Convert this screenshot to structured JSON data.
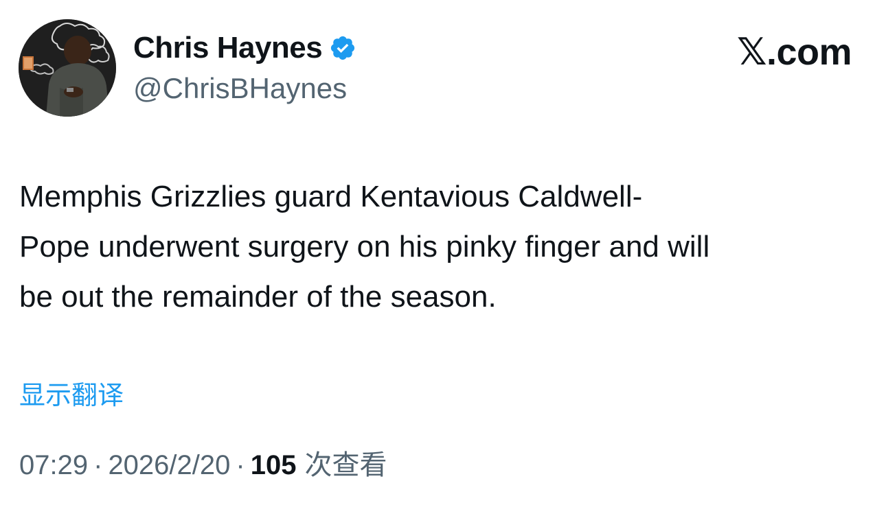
{
  "author": {
    "display_name": "Chris Haynes",
    "handle": "@ChrisBHaynes",
    "verified_icon": "verified-badge-icon",
    "avatar_icon": "profile-photo"
  },
  "site": {
    "label": "𝕏.com"
  },
  "tweet": {
    "lines": [
      "Memphis Grizzlies guard Kentavious Caldwell-",
      "Pope underwent surgery on his pinky finger and will",
      "be out the remainder of the season."
    ]
  },
  "translate": {
    "label": "显示翻译"
  },
  "meta": {
    "time": "07:29",
    "separator": "·",
    "date": "2026/2/20",
    "views_count": "105",
    "views_label": "次查看"
  },
  "colors": {
    "accent": "#1d9bf0",
    "text": "#0f1419",
    "secondary": "#536471"
  }
}
